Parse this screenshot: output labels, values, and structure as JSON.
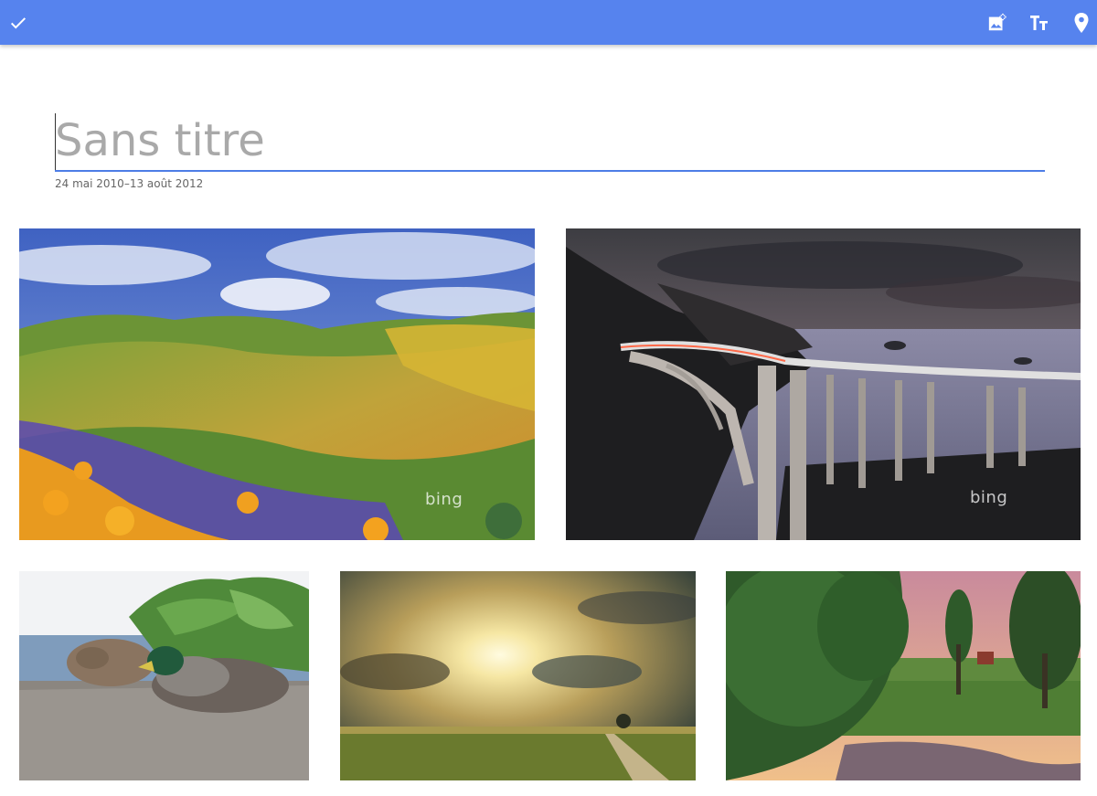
{
  "toolbar": {
    "background_color": "#5683ee",
    "left_icon": "check-icon",
    "right_icons": [
      "add-photo-icon",
      "text-size-icon",
      "location-pin-icon"
    ]
  },
  "album": {
    "title_placeholder": "Sans titre",
    "date_range": "24 mai 2010–13 août 2012"
  },
  "photos": [
    {
      "subject": "wildflower hills",
      "watermark": "bing"
    },
    {
      "subject": "arched coastal bridge at dusk",
      "watermark": "bing"
    },
    {
      "subject": "two ducks resting"
    },
    {
      "subject": "sun rays over fields"
    },
    {
      "subject": "forest creek at sunset"
    }
  ]
}
